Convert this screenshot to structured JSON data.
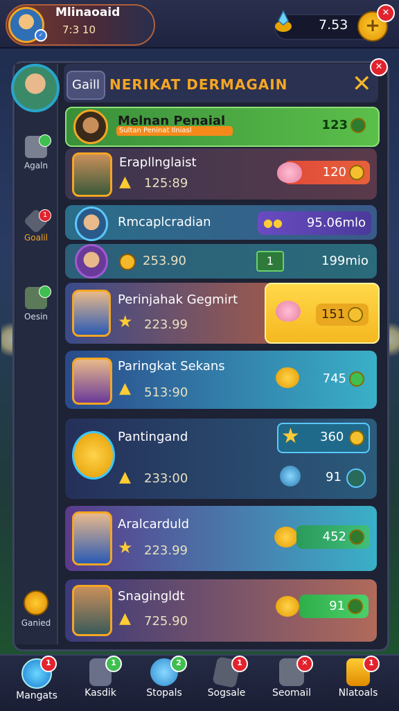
{
  "top_bar": {
    "player_name": "Mlinaoaid",
    "player_time": "7:3 10",
    "currency_value": "7.53",
    "add_button_label": "+"
  },
  "sidebar": {
    "items": [
      {
        "label": "Agaln",
        "badge": ""
      },
      {
        "label": "Goalil",
        "badge": "1"
      },
      {
        "label": "Oesin",
        "badge": ""
      },
      {
        "label": "Ganied",
        "badge": ""
      }
    ]
  },
  "header": {
    "tab_label": "Gaill",
    "title": "NERIKAT DERMAGAIN",
    "close_icon": "✕"
  },
  "rows": [
    {
      "name": "Melnan Penaial",
      "subtitle": "Sultan Peninat Ilniasl",
      "reward": "123",
      "color": "#4caf50"
    },
    {
      "name": "Erapllnglaist",
      "score": "125:89",
      "reward": "120",
      "color": "#e74c3c"
    },
    {
      "name": "Rmcaplcradian",
      "reward": "95.06mlo",
      "color": "#6a4bc2"
    },
    {
      "name": "",
      "score": "253.90",
      "reward_badge": "1",
      "reward": "199mio",
      "color": "#2e7a8a"
    },
    {
      "name": "Perinjahak Gegmirt",
      "score": "223.99",
      "reward": "151",
      "color": "#f5c430"
    },
    {
      "name": "Paringkat Sekans",
      "score": "513:90",
      "reward": "745",
      "color": "#3fb6c8"
    },
    {
      "name": "Pantingand",
      "score": "233:00",
      "reward": "360",
      "reward2": "91",
      "color": "#2b6a8a"
    },
    {
      "name": "Aralcarduld",
      "score": "223.99",
      "reward": "452",
      "color": "#3fb6c8"
    },
    {
      "name": "Snagingldt",
      "score": "725.90",
      "reward": "91",
      "color": "#34c06a"
    }
  ],
  "bottom_nav": [
    {
      "label": "Mangats",
      "badge": "1"
    },
    {
      "label": "Kasdik",
      "badge": "1"
    },
    {
      "label": "Stopals",
      "badge": "2"
    },
    {
      "label": "Sogsale",
      "badge": "1"
    },
    {
      "label": "Seomail",
      "badge": "✕"
    },
    {
      "label": "Nlatoals",
      "badge": "1"
    }
  ],
  "colors": {
    "accent_orange": "#f5a623",
    "badge_red": "#e2232e",
    "badge_green": "#3fbf4f"
  }
}
